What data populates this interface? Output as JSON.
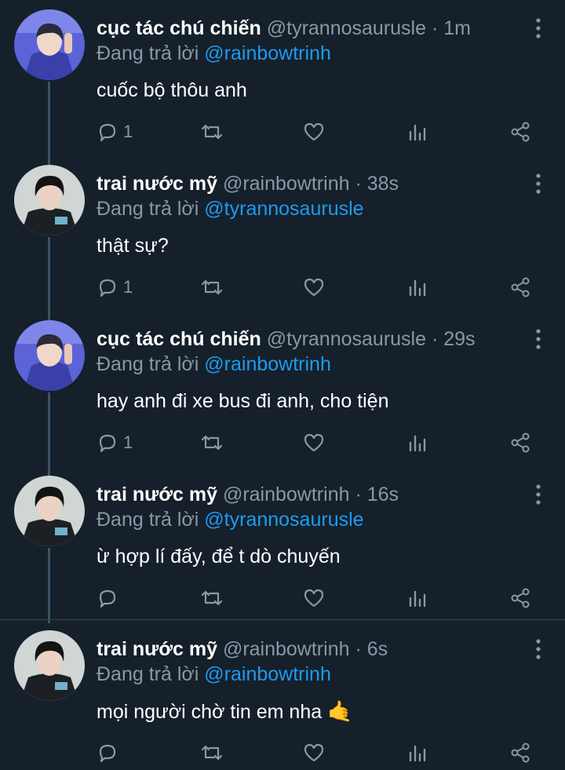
{
  "tweets": [
    {
      "name": "cục tác chú chiến",
      "handle": "@tyrannosaurusle",
      "dot": "·",
      "time": "1m",
      "reply_prefix": "Đang trả lời",
      "reply_to": "@rainbowtrinh",
      "text": "cuốc bộ thôu anh",
      "reply_count": "1",
      "avatar": "avatar-cuc-tac"
    },
    {
      "name": "trai nước mỹ",
      "handle": "@rainbowtrinh",
      "dot": "·",
      "time": "38s",
      "reply_prefix": "Đang trả lời",
      "reply_to": "@tyrannosaurusle",
      "text": "thật sự?",
      "reply_count": "1",
      "avatar": "avatar-trai-nuoc-my"
    },
    {
      "name": "cục tác chú chiến",
      "handle": "@tyrannosaurusle",
      "dot": "·",
      "time": "29s",
      "reply_prefix": "Đang trả lời",
      "reply_to": "@rainbowtrinh",
      "text": "hay anh đi xe bus đi anh, cho tiện",
      "reply_count": "1",
      "avatar": "avatar-cuc-tac"
    },
    {
      "name": "trai nước mỹ",
      "handle": "@rainbowtrinh",
      "dot": "·",
      "time": "16s",
      "reply_prefix": "Đang trả lời",
      "reply_to": "@tyrannosaurusle",
      "text": "ừ hợp lí đấy, để t dò chuyến",
      "reply_count": "",
      "avatar": "avatar-trai-nuoc-my"
    },
    {
      "name": "trai nước mỹ",
      "handle": "@rainbowtrinh",
      "dot": "·",
      "time": "6s",
      "reply_prefix": "Đang trả lời",
      "reply_to": "@rainbowtrinh",
      "text": "mọi người chờ tin em nha",
      "emoji": "🤙",
      "reply_count": "",
      "avatar": "avatar-trai-nuoc-my"
    }
  ],
  "colors": {
    "background": "#15202b",
    "muted": "#8899a6",
    "mention": "#1d9bf0",
    "thread_line": "#3d5466"
  },
  "icons": [
    "reply-icon",
    "retweet-icon",
    "like-icon",
    "analytics-icon",
    "share-icon",
    "more-icon"
  ]
}
